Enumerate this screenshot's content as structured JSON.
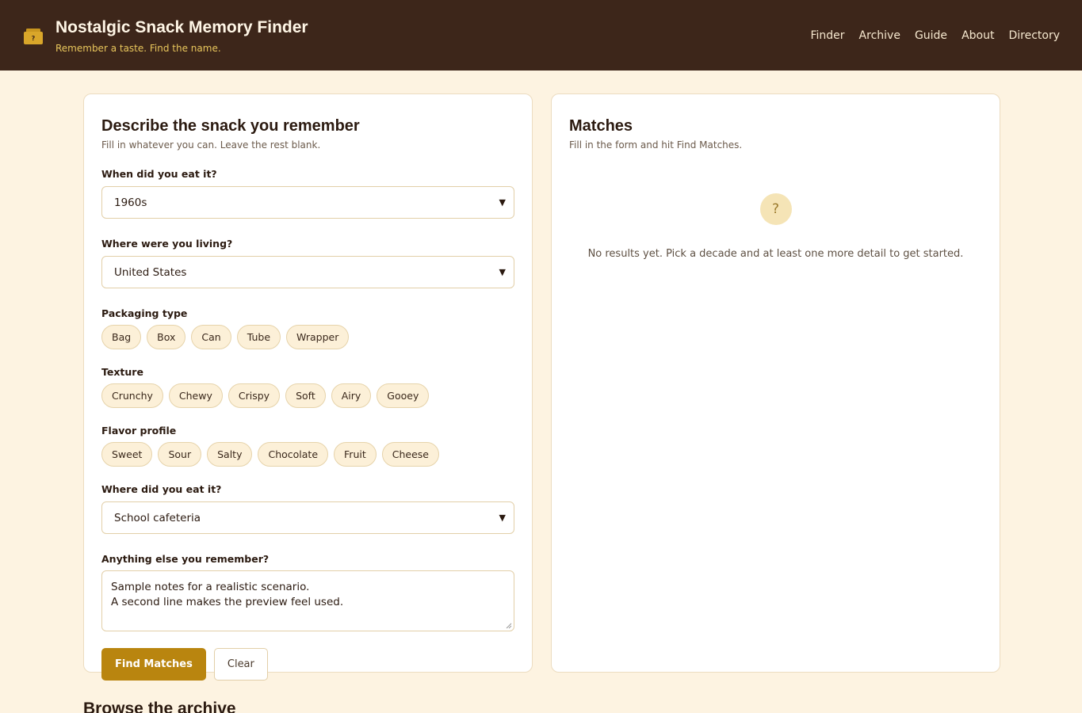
{
  "brand": {
    "title": "Nostalgic Snack Memory Finder",
    "tagline": "Remember a taste. Find the name.",
    "logo_icon": "snack-box-icon",
    "logo_mark": "?"
  },
  "nav": {
    "items": [
      "Finder",
      "Archive",
      "Guide",
      "About",
      "Directory"
    ]
  },
  "form": {
    "title": "Describe the snack you remember",
    "subtitle": "Fill in whatever you can. Leave the rest blank.",
    "decade": {
      "label": "When did you eat it?",
      "value": "1960s"
    },
    "location": {
      "label": "Where were you living?",
      "value": "United States"
    },
    "packaging": {
      "label": "Packaging type",
      "options": [
        "Bag",
        "Box",
        "Can",
        "Tube",
        "Wrapper"
      ]
    },
    "texture": {
      "label": "Texture",
      "options": [
        "Crunchy",
        "Chewy",
        "Crispy",
        "Soft",
        "Airy",
        "Gooey"
      ]
    },
    "flavor": {
      "label": "Flavor profile",
      "options": [
        "Sweet",
        "Sour",
        "Salty",
        "Chocolate",
        "Fruit",
        "Cheese"
      ]
    },
    "place": {
      "label": "Where did you eat it?",
      "value": "School cafeteria"
    },
    "notes": {
      "label": "Anything else you remember?",
      "line1": "Sample notes for a realistic scenario.",
      "line2": "A second line makes the preview feel used."
    },
    "find_label": "Find Matches",
    "clear_label": "Clear"
  },
  "results": {
    "title": "Matches",
    "subtitle": "Fill in the form and hit Find Matches.",
    "empty_icon": "?",
    "empty_text": "No results yet. Pick a decade and at least one more detail to get started."
  },
  "archive": {
    "title": "Browse the archive"
  },
  "colors": {
    "header_bg": "#3d261a",
    "page_bg": "#fdf3e1",
    "accent": "#b9850f",
    "tagline": "#e8c65c",
    "chip_bg": "#fcf0d8"
  }
}
